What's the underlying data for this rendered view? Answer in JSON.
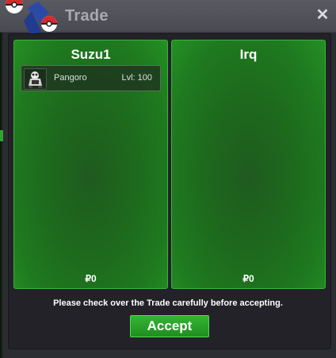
{
  "window": {
    "title": "Trade",
    "close_icon": "close-icon"
  },
  "trade": {
    "left": {
      "player": "Suzu1",
      "money": "₽0",
      "items": [
        {
          "icon": "pangoro-sprite-icon",
          "name": "Pangoro",
          "level": "Lvl: 100"
        }
      ]
    },
    "right": {
      "player": "Irq",
      "money": "₽0",
      "items": []
    }
  },
  "notice": "Please check over the Trade carefully before accepting.",
  "accept_label": "Accept",
  "colors": {
    "panel_green": "#1f7a1f",
    "accept_green": "#2aa52a",
    "title_bar": "#55555e"
  }
}
